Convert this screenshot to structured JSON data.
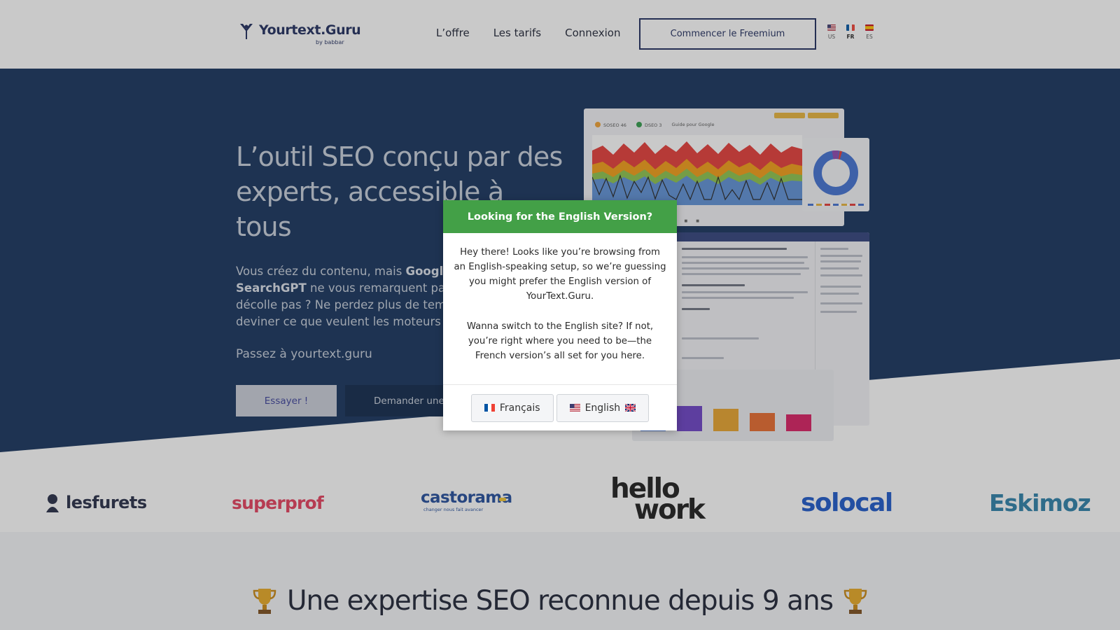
{
  "header": {
    "brand": "Yourtext.Guru",
    "brand_sub": "by babbar",
    "nav": [
      "L’offre",
      "Les tarifs",
      "Connexion"
    ],
    "cta": "Commencer le Freemium",
    "languages": [
      {
        "code": "US",
        "icon": "us-flag-icon",
        "active": false
      },
      {
        "code": "FR",
        "icon": "fr-flag-icon",
        "active": true
      },
      {
        "code": "ES",
        "icon": "es-flag-icon",
        "active": false
      }
    ]
  },
  "hero": {
    "title": "L’outil SEO conçu par des experts, accessible à tous",
    "text_line1_pre": "Vous créez du contenu, mais ",
    "text_line1_bold": "Google",
    "text_line2_bold": "SearchGPT",
    "text_line2_post": " ne vous remarquent pas",
    "text_line3": "décolle pas ? Ne perdez plus de temps",
    "text_line4": "deviner ce que veulent les moteurs",
    "subline": "Passez à yourtext.guru",
    "btn_try": "Essayer !",
    "btn_demo": "Demander une démo",
    "mock_tags": [
      "SOSEO 46",
      "DSEO 3",
      "Guide pour Google"
    ]
  },
  "logos": [
    "lesfurets",
    "superprof",
    "castorama",
    "changer nous fait avancer",
    "hello",
    "work",
    "solocal",
    "Eskimoz"
  ],
  "section": {
    "title": "Une expertise SEO reconnue depuis 9 ans",
    "icon": "trophy-icon"
  },
  "modal": {
    "title": "Looking for the English Version?",
    "para1": "Hey there! Looks like you’re browsing from an English-speaking setup, so we’re guessing you might prefer the English version of YourText.Guru.",
    "para2": "Wanna switch to the English site? If not, you’re right where you need to be—the French version’s all set for you here.",
    "btn_fr": "Français",
    "btn_en": "English"
  },
  "colors": {
    "hero_bg": "#12305a",
    "modal_header": "#43a047",
    "brand_navy": "#1d2a5c"
  }
}
